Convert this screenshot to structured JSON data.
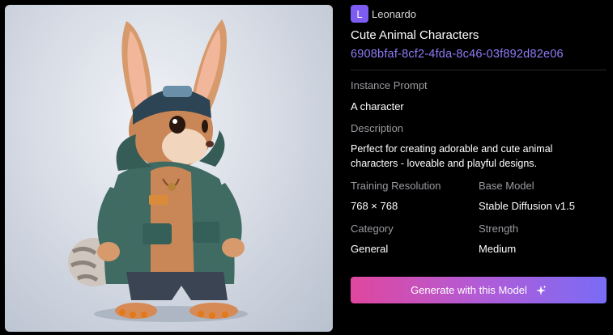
{
  "owner": {
    "avatar_letter": "L",
    "name": "Leonardo"
  },
  "model": {
    "title": "Cute Animal Characters",
    "id": "6908bfaf-8cf2-4fda-8c46-03f892d82e06"
  },
  "fields": {
    "instance_prompt_label": "Instance Prompt",
    "instance_prompt_value": "A character",
    "description_label": "Description",
    "description_value": "Perfect for creating adorable and cute animal characters - loveable and playful designs.",
    "training_resolution_label": "Training Resolution",
    "training_resolution_value": "768 × 768",
    "base_model_label": "Base Model",
    "base_model_value": "Stable Diffusion v1.5",
    "category_label": "Category",
    "category_value": "General",
    "strength_label": "Strength",
    "strength_value": "Medium"
  },
  "action": {
    "generate_label": "Generate with this Model",
    "icon": "sparkle-icon"
  },
  "colors": {
    "accent": "#8f7cf7",
    "avatar": "#7c5cf2",
    "gradient_start": "#e0479e",
    "gradient_end": "#7a6cf5"
  }
}
